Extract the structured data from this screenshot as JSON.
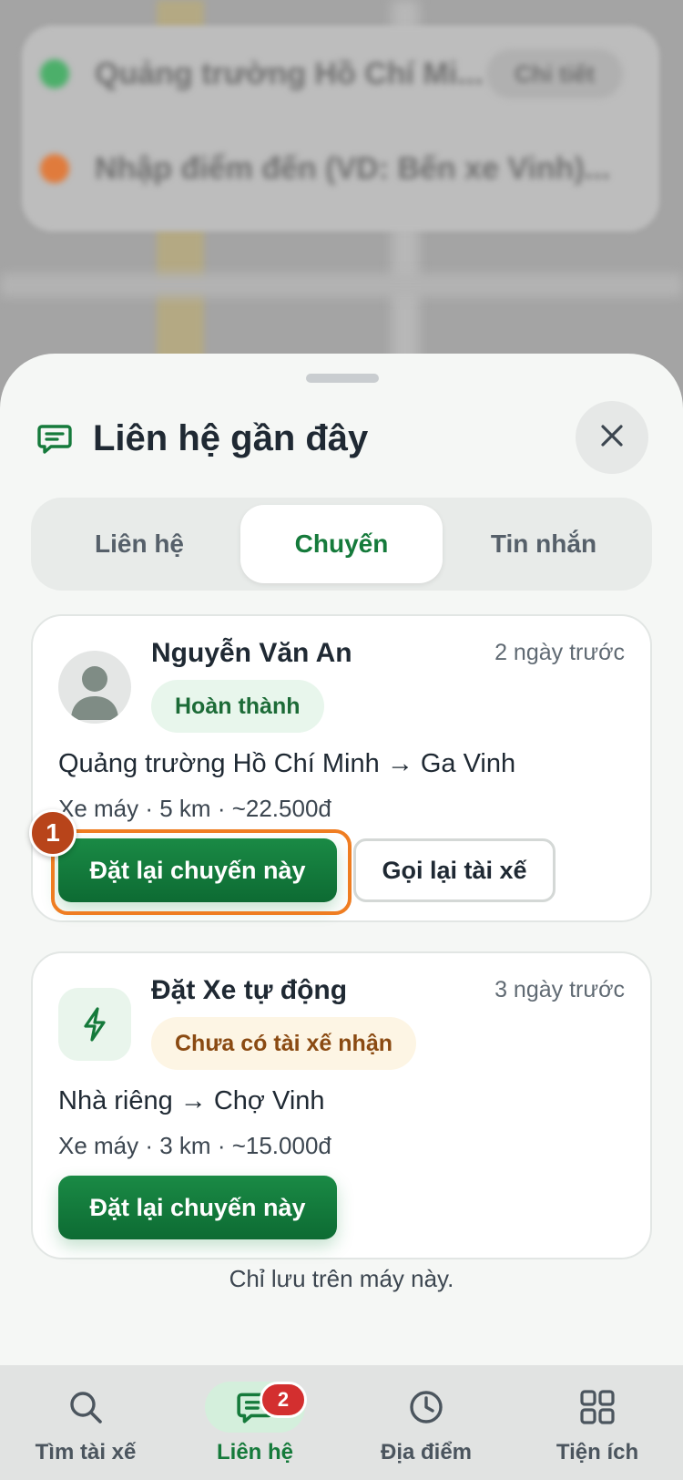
{
  "background": {
    "search_rows": [
      {
        "text": "Quảng trường Hồ Chí Mi...",
        "pill": "Chi tiết",
        "dot_color": "#4caf6a"
      },
      {
        "text": "Nhập điểm đến (VD: Bến xe Vinh)...",
        "dot_color": "#e07b3c"
      }
    ]
  },
  "sheet": {
    "title": "Liên hệ gần đây",
    "header_icon": "chat-icon",
    "close_icon": "close-icon",
    "tabs": [
      {
        "label": "Liên hệ",
        "active": false
      },
      {
        "label": "Chuyến",
        "active": true
      },
      {
        "label": "Tin nhắn",
        "active": false
      }
    ],
    "trips": [
      {
        "name": "Nguyễn Văn An",
        "time": "2 ngày trước",
        "status": "Hoàn thành",
        "route": "Quảng trường Hồ Chí Minh → Ga Vinh",
        "meta": "Xe máy · 5 km · ~22.500đ",
        "rebook_label": "Đặt lại chuyến này",
        "call_label": "Gọi lại tài xế",
        "marker": "1"
      },
      {
        "name": "Đặt Xe tự động",
        "time": "3 ngày trước",
        "status": "Chưa có tài xế nhận",
        "route": "Nhà riêng → Chợ Vinh",
        "meta": "Xe máy · 3 km · ~15.000đ",
        "rebook_label": "Đặt lại chuyến này"
      }
    ],
    "footnote": "Chỉ lưu trên máy này."
  },
  "bottom_nav": {
    "items": [
      {
        "label": "Tìm tài xế",
        "icon": "search-icon",
        "active": false
      },
      {
        "label": "Liên hệ",
        "icon": "chat-icon",
        "active": true,
        "badge": "2"
      },
      {
        "label": "Địa điểm",
        "icon": "clock-icon",
        "active": false
      },
      {
        "label": "Tiện ích",
        "icon": "grid-icon",
        "active": false
      }
    ]
  },
  "colors": {
    "primary_green": "#157a3b",
    "highlight_orange": "#ef7d21",
    "badge_red": "#d32f2f"
  }
}
